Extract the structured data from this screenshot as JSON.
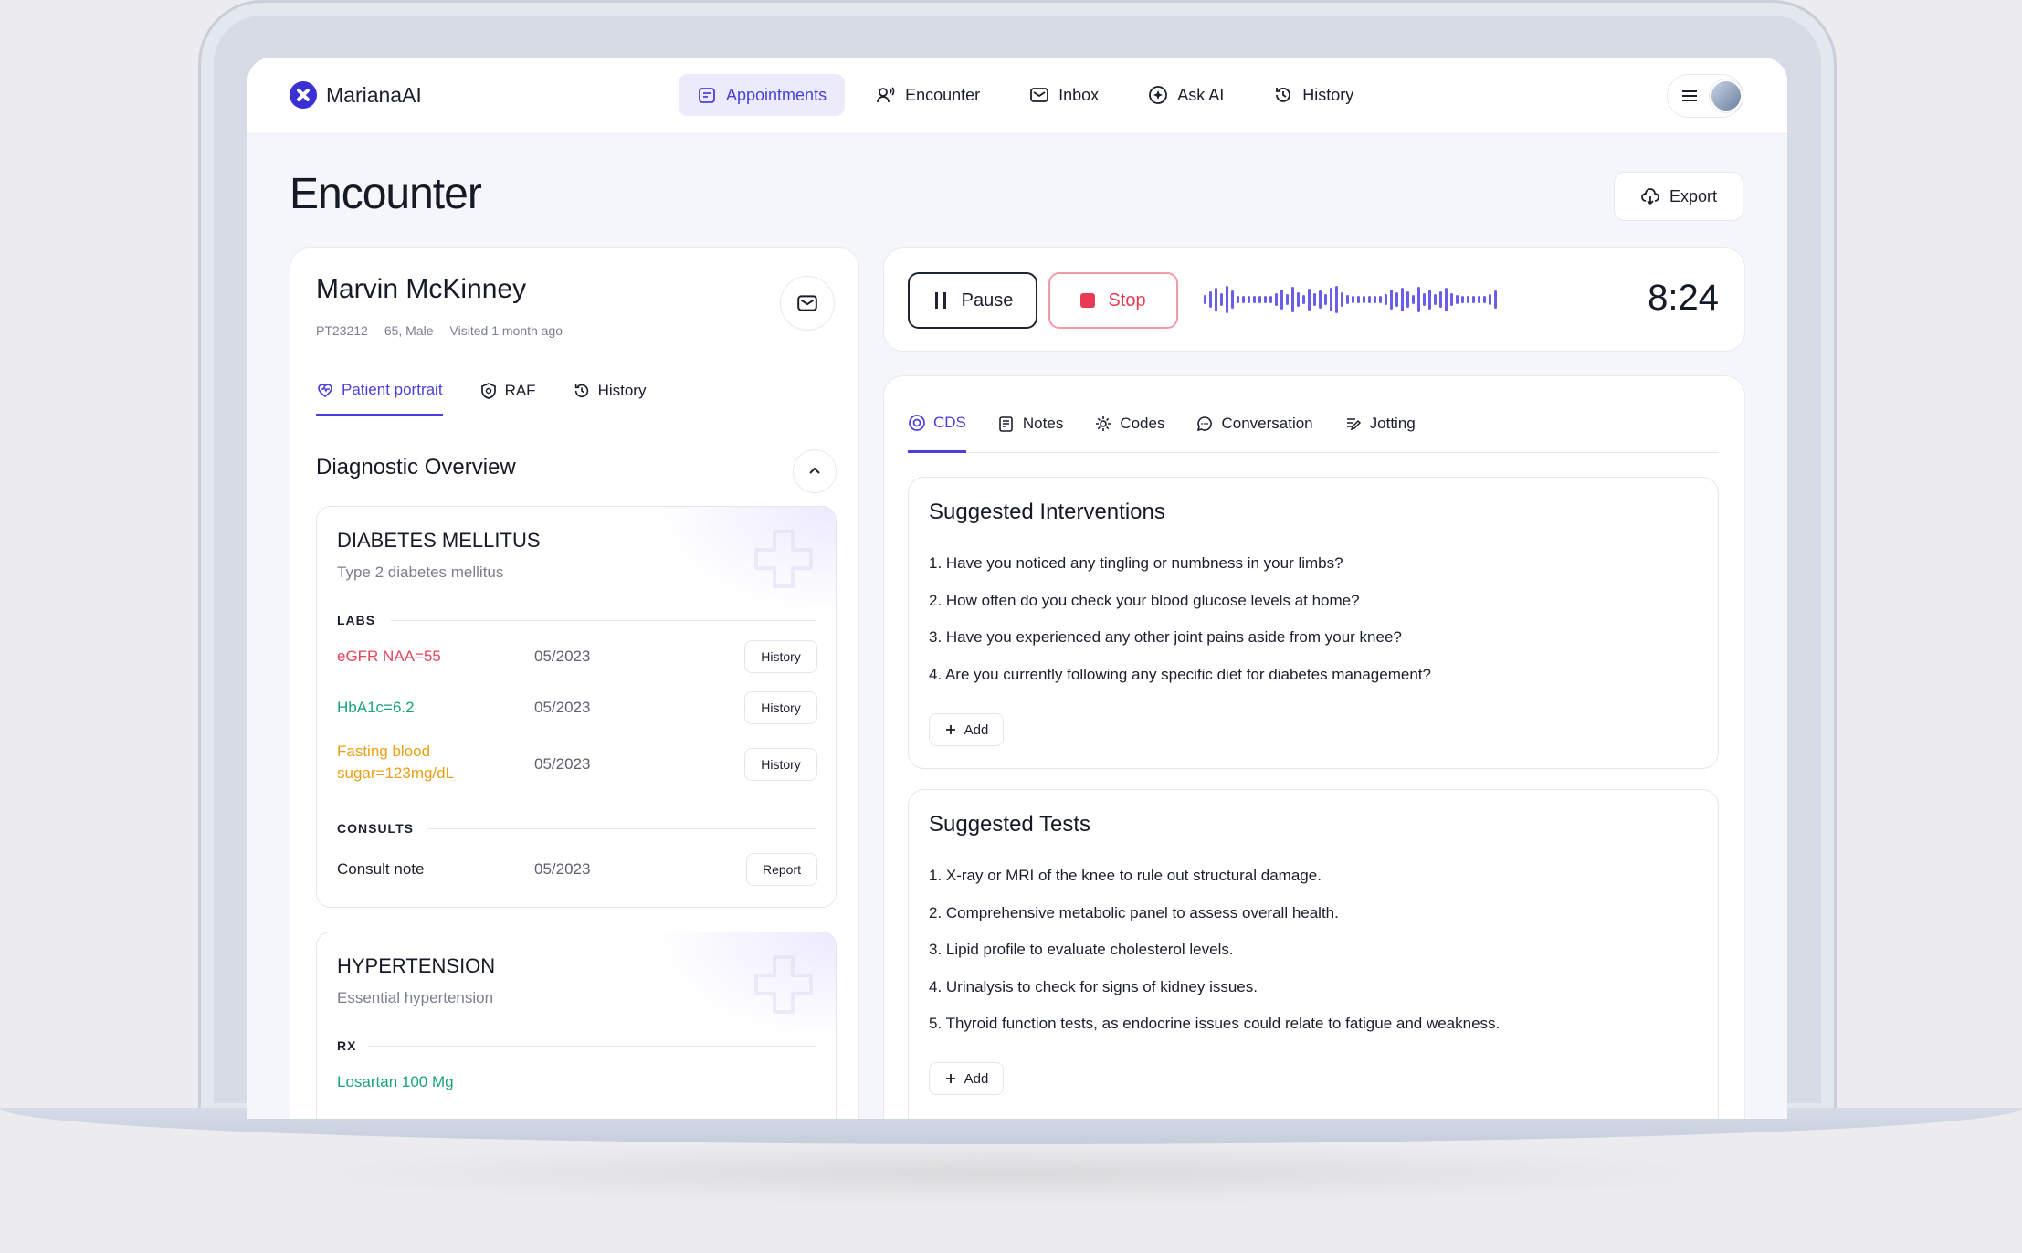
{
  "app": {
    "logo_text": "MarianaAI"
  },
  "nav": {
    "items": [
      {
        "label": "Appointments",
        "icon": "calendar-icon",
        "active": true
      },
      {
        "label": "Encounter",
        "icon": "user-voice-icon"
      },
      {
        "label": "Inbox",
        "icon": "mail-icon"
      },
      {
        "label": "Ask AI",
        "icon": "sparkle-icon"
      },
      {
        "label": "History",
        "icon": "history-icon"
      }
    ]
  },
  "page": {
    "title": "Encounter",
    "export_label": "Export"
  },
  "patient": {
    "name": "Marvin McKinney",
    "id": "PT23212",
    "age_sex": "65, Male",
    "visited": "Visited 1 month ago",
    "tabs": [
      {
        "label": "Patient portrait",
        "active": true
      },
      {
        "label": "RAF"
      },
      {
        "label": "History"
      }
    ]
  },
  "diagnostic": {
    "title": "Diagnostic Overview",
    "conditions": [
      {
        "name": "DIABETES MELLITUS",
        "subtitle": "Type 2 diabetes mellitus",
        "labs_label": "LABS",
        "labs": [
          {
            "name": "eGFR NAA=55",
            "date": "05/2023",
            "button": "History",
            "color": "#e2475f"
          },
          {
            "name": "HbA1c=6.2",
            "date": "05/2023",
            "button": "History",
            "color": "#1aa37a"
          },
          {
            "name": "Fasting blood sugar=123mg/dL",
            "name_line1": "Fasting blood",
            "name_line2": "sugar=123mg/dL",
            "date": "05/2023",
            "button": "History",
            "color": "#e8a116"
          }
        ],
        "consults_label": "CONSULTS",
        "consults": [
          {
            "name": "Consult note",
            "date": "05/2023",
            "button": "Report"
          }
        ]
      },
      {
        "name": "HYPERTENSION",
        "subtitle": "Essential hypertension",
        "rx_label": "RX",
        "rx": [
          {
            "name": "Losartan 100 Mg",
            "color": "#1aa37a"
          }
        ]
      }
    ]
  },
  "recorder": {
    "pause_label": "Pause",
    "stop_label": "Stop",
    "timer": "8:24"
  },
  "main_tabs": [
    {
      "label": "CDS",
      "active": true
    },
    {
      "label": "Notes"
    },
    {
      "label": "Codes"
    },
    {
      "label": "Conversation"
    },
    {
      "label": "Jotting"
    }
  ],
  "interventions": {
    "title": "Suggested Interventions",
    "items": [
      "1. Have you noticed any tingling or numbness in your limbs?",
      "2. How often do you check your blood glucose levels at home?",
      "3. Have you experienced any other joint pains aside from your knee?",
      "4. Are you currently following any specific diet for diabetes management?"
    ],
    "add_label": "Add"
  },
  "tests": {
    "title": "Suggested Tests",
    "items": [
      "1. X-ray or MRI of the knee to rule out structural damage.",
      "2. Comprehensive metabolic panel to assess overall health.",
      "3. Lipid profile to evaluate cholesterol levels.",
      "4. Urinalysis to check for signs of kidney issues.",
      "5. Thyroid function tests, as endocrine issues could relate to fatigue and weakness."
    ],
    "add_label": "Add"
  },
  "colors": {
    "accent": "#4a3fd9",
    "danger": "#e63a55",
    "success": "#1aa37a",
    "warning": "#e8a116"
  }
}
